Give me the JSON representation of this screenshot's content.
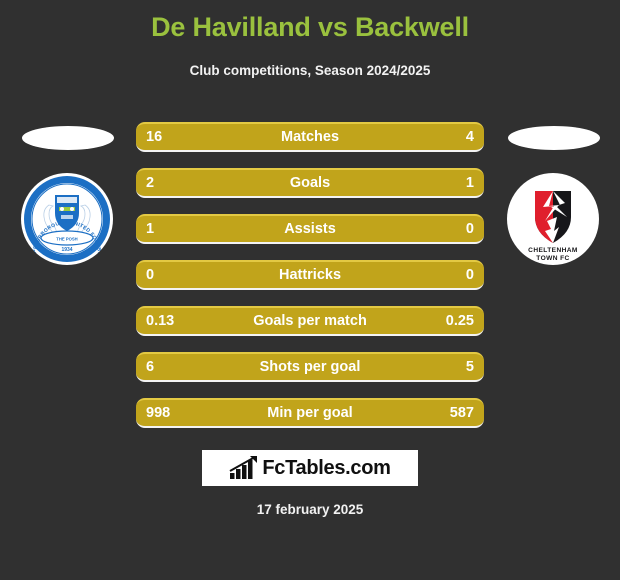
{
  "header": {
    "title": "De Havilland vs Backwell",
    "subtitle": "Club competitions, Season 2024/2025",
    "title_color": "#9ac13e"
  },
  "teams": {
    "home": {
      "crest_name": "peterborough-united-fc-crest",
      "crest_text_outer": "PETERBOROUGH UNITED FOOTBALL CLUB",
      "crest_year": "1934",
      "colors": {
        "primary": "#1c6fc4",
        "secondary": "#ffffff"
      }
    },
    "away": {
      "crest_name": "cheltenham-town-fc-crest",
      "crest_text_line1": "CHELTENHAM",
      "crest_text_line2": "TOWN FC",
      "colors": {
        "primary": "#e01f2d",
        "secondary": "#17171a"
      }
    }
  },
  "stats": {
    "bar_color": "#c1a41b",
    "rows": [
      {
        "label": "Matches",
        "home": "16",
        "away": "4"
      },
      {
        "label": "Goals",
        "home": "2",
        "away": "1"
      },
      {
        "label": "Assists",
        "home": "1",
        "away": "0"
      },
      {
        "label": "Hattricks",
        "home": "0",
        "away": "0"
      },
      {
        "label": "Goals per match",
        "home": "0.13",
        "away": "0.25"
      },
      {
        "label": "Shots per goal",
        "home": "6",
        "away": "5"
      },
      {
        "label": "Min per goal",
        "home": "998",
        "away": "587"
      }
    ]
  },
  "footer": {
    "logo_text": "FcTables.com",
    "logo_icon": "bar-chart-arrow-icon",
    "date": "17 february 2025"
  }
}
